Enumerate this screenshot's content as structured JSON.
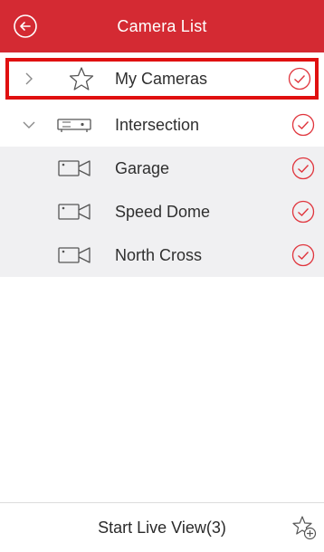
{
  "header": {
    "title": "Camera List",
    "back_icon": "back-circle-icon",
    "bg_color": "#d42a33"
  },
  "list": {
    "my_cameras": {
      "label": "My Cameras",
      "icon": "star-icon",
      "expanded": false,
      "selected": true
    },
    "group": {
      "label": "Intersection",
      "icon": "nvr-device-icon",
      "expanded": true,
      "cameras": [
        {
          "label": "Garage",
          "icon": "camera-icon"
        },
        {
          "label": "Speed Dome",
          "icon": "camera-icon"
        },
        {
          "label": "North Cross",
          "icon": "camera-icon"
        }
      ]
    },
    "check_icon": "check-circle-icon",
    "accent_color": "#e0353d"
  },
  "footer": {
    "start_label": "Start Live View(3)",
    "fav_icon": "add-favorite-star-icon"
  }
}
